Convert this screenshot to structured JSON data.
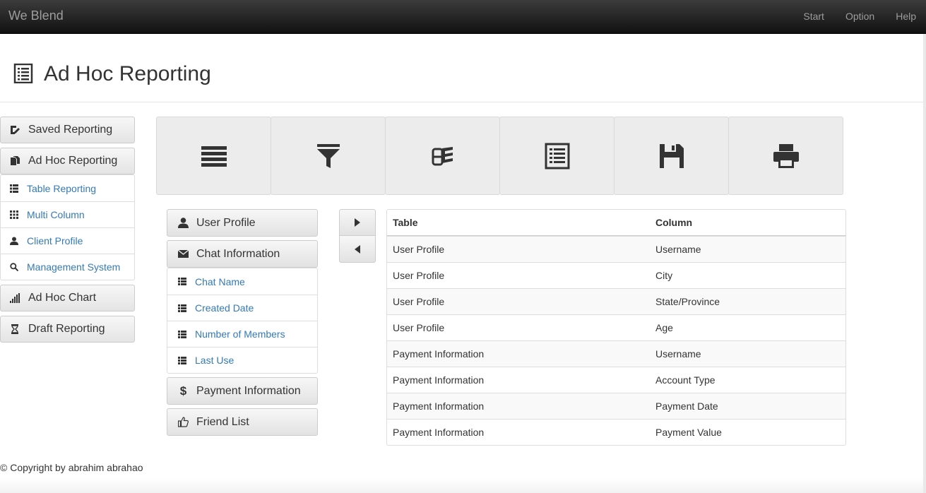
{
  "app": {
    "brand": "We Blend"
  },
  "nav": {
    "links": [
      "Start",
      "Option",
      "Help"
    ]
  },
  "page": {
    "title": "Ad Hoc Reporting"
  },
  "sidebar": {
    "saved_label": "Saved Reporting",
    "adhoc_label": "Ad Hoc Reporting",
    "adhoc_items": [
      {
        "label": "Table Reporting",
        "icon": "th-list-icon"
      },
      {
        "label": "Multi Column",
        "icon": "grid-icon"
      },
      {
        "label": "Client Profile",
        "icon": "user-icon"
      },
      {
        "label": "Management System",
        "icon": "search-icon"
      }
    ],
    "chart_label": "Ad Hoc Chart",
    "draft_label": "Draft Reporting"
  },
  "toolbar": {
    "icons": [
      "list-icon",
      "filter-icon",
      "database-icon",
      "report-icon",
      "save-icon",
      "print-icon"
    ]
  },
  "fields": {
    "user_profile": "User Profile",
    "chat_information": "Chat Information",
    "chat_items": [
      "Chat Name",
      "Created Date",
      "Number of Members",
      "Last Use"
    ],
    "payment_information": "Payment Information",
    "friend_list": "Friend List"
  },
  "table": {
    "headers": [
      "Table",
      "Column"
    ],
    "rows": [
      [
        "User Profile",
        "Username"
      ],
      [
        "User Profile",
        "City"
      ],
      [
        "User Profile",
        "State/Province"
      ],
      [
        "User Profile",
        "Age"
      ],
      [
        "Payment Information",
        "Username"
      ],
      [
        "Payment Information",
        "Account Type"
      ],
      [
        "Payment Information",
        "Payment Date"
      ],
      [
        "Payment Information",
        "Payment Value"
      ]
    ]
  },
  "footer": {
    "text": "© Copyright by abrahim abrahao"
  },
  "colors": {
    "link": "#337ab7",
    "navbar": "#222222",
    "navtext": "#9d9d9d"
  }
}
